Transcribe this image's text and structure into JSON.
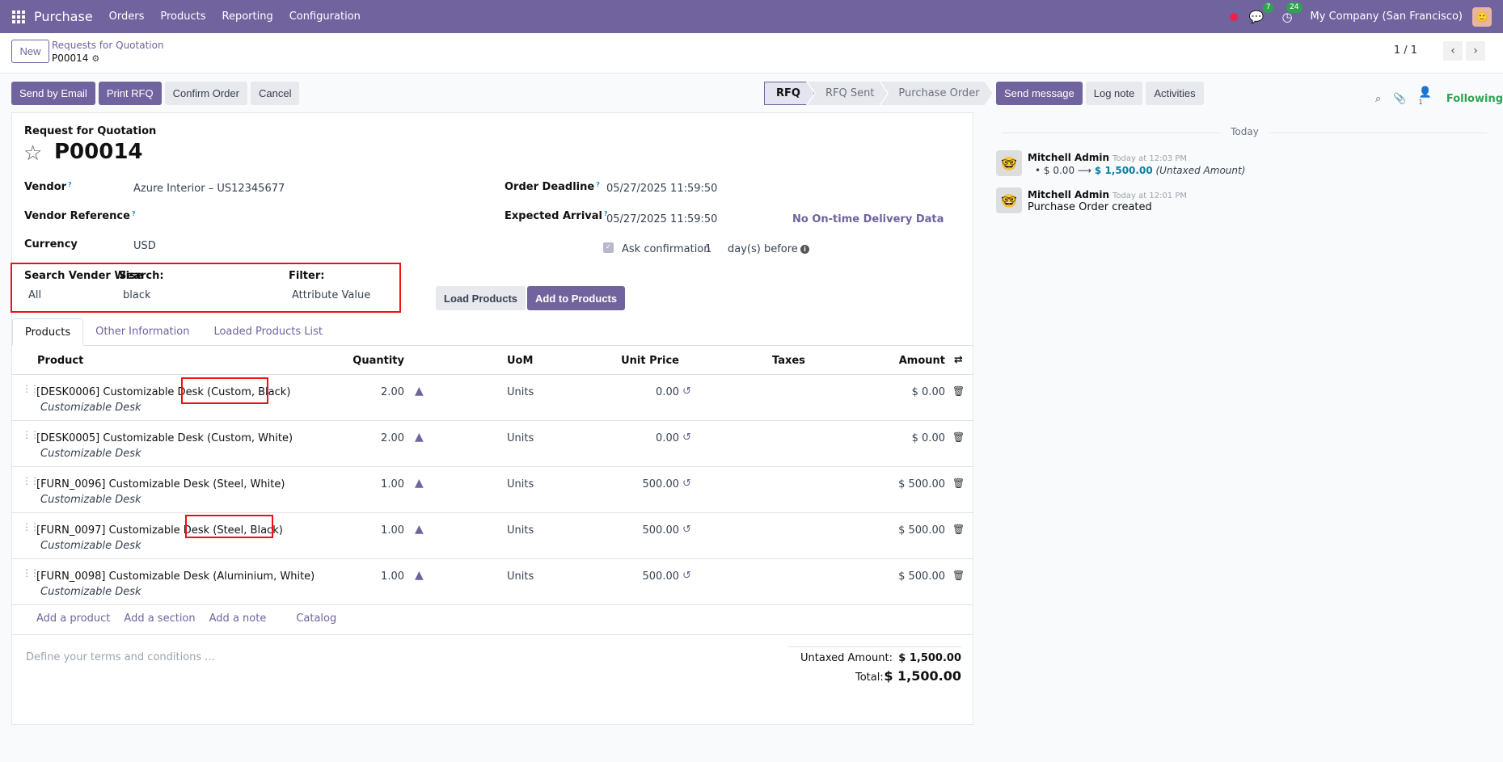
{
  "nav": {
    "brand": "Purchase",
    "menu": [
      "Orders",
      "Products",
      "Reporting",
      "Configuration"
    ],
    "chat_count": "7",
    "activity_count": "24",
    "company": "My Company (San Francisco)"
  },
  "control": {
    "new": "New",
    "breadcrumb_parent": "Requests for Quotation",
    "breadcrumb_current": "P00014",
    "pager": "1 / 1"
  },
  "actions": {
    "send_email": "Send by Email",
    "print_rfq": "Print RFQ",
    "confirm": "Confirm Order",
    "cancel": "Cancel"
  },
  "status": [
    "RFQ",
    "RFQ Sent",
    "Purchase Order"
  ],
  "form": {
    "kind": "Request for Quotation",
    "name": "P00014",
    "vendor_label": "Vendor",
    "vendor": "Azure Interior – US12345677",
    "vendor_ref_label": "Vendor Reference",
    "currency_label": "Currency",
    "currency": "USD",
    "deadline_label": "Order Deadline",
    "deadline": "05/27/2025 11:59:50",
    "arrival_label": "Expected Arrival",
    "arrival": "05/27/2025 11:59:50",
    "ontime": "No On-time Delivery Data",
    "ask_conf": "Ask confirmation",
    "ask_days": "1",
    "days_before": "day(s) before",
    "svw_label": "Search Vender Wise",
    "svw_value": "All",
    "search_label": "Search:",
    "search_value": "black",
    "filter_label": "Filter:",
    "filter_value": "Attribute Value",
    "load_products": "Load Products",
    "add_products": "Add to Products"
  },
  "tabs": [
    "Products",
    "Other Information",
    "Loaded Products List"
  ],
  "columns": {
    "product": "Product",
    "quantity": "Quantity",
    "uom": "UoM",
    "unit_price": "Unit Price",
    "taxes": "Taxes",
    "amount": "Amount"
  },
  "lines": [
    {
      "name": "[DESK0006] Customizable Desk (Custom, Black)",
      "desc": "Customizable Desk",
      "qty": "2.00",
      "uom": "Units",
      "price": "0.00",
      "amount": "$ 0.00"
    },
    {
      "name": "[DESK0005] Customizable Desk (Custom, White)",
      "desc": "Customizable Desk",
      "qty": "2.00",
      "uom": "Units",
      "price": "0.00",
      "amount": "$ 0.00"
    },
    {
      "name": "[FURN_0096] Customizable Desk (Steel, White)",
      "desc": "Customizable Desk",
      "qty": "1.00",
      "uom": "Units",
      "price": "500.00",
      "amount": "$ 500.00"
    },
    {
      "name": "[FURN_0097] Customizable Desk (Steel, Black)",
      "desc": "Customizable Desk",
      "qty": "1.00",
      "uom": "Units",
      "price": "500.00",
      "amount": "$ 500.00"
    },
    {
      "name": "[FURN_0098] Customizable Desk (Aluminium, White)",
      "desc": "Customizable Desk",
      "qty": "1.00",
      "uom": "Units",
      "price": "500.00",
      "amount": "$ 500.00"
    }
  ],
  "add_links": [
    "Add a product",
    "Add a section",
    "Add a note",
    "Catalog"
  ],
  "terms_placeholder": "Define your terms and conditions ...",
  "totals": {
    "untaxed_label": "Untaxed Amount:",
    "untaxed": "$ 1,500.00",
    "total_label": "Total:",
    "total": "$ 1,500.00"
  },
  "chatter": {
    "send_message": "Send message",
    "log_note": "Log note",
    "activities": "Activities",
    "followers": "1",
    "following": "Following",
    "today": "Today",
    "messages": [
      {
        "author": "Mitchell Admin",
        "time": "Today at 12:03 PM",
        "old": "$ 0.00",
        "new": "$ 1,500.00",
        "field": "(Untaxed Amount)"
      },
      {
        "author": "Mitchell Admin",
        "time": "Today at 12:01 PM",
        "body": "Purchase Order created"
      }
    ]
  },
  "colors": {
    "brand": "#71639e",
    "highlight": "#e11111",
    "success": "#2ea44f"
  }
}
